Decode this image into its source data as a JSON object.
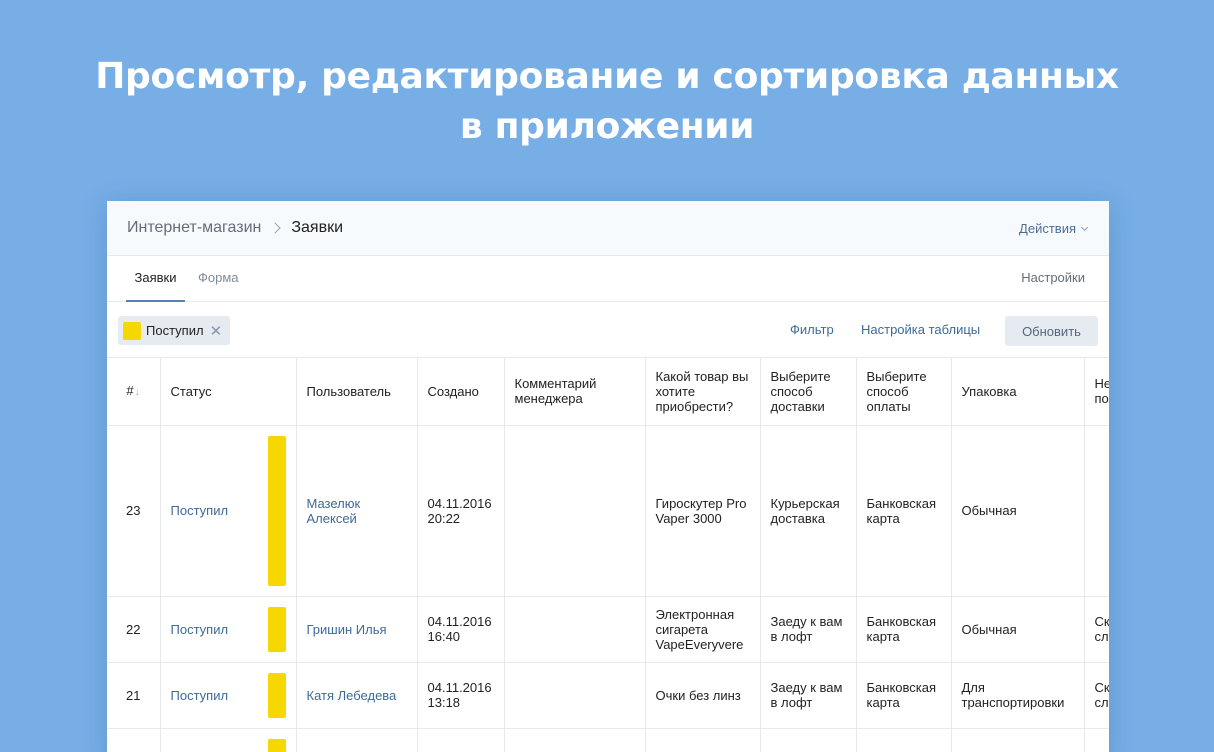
{
  "hero": {
    "line1": "Просмотр, редактирование и сортировка данных",
    "line2": "в приложении"
  },
  "window": {
    "breadcrumb": {
      "parent": "Интернет-магазин",
      "current": "Заявки"
    },
    "actions_label": "Действия",
    "tabs": [
      {
        "label": "Заявки",
        "active": true
      },
      {
        "label": "Форма",
        "active": false
      }
    ],
    "settings_label": "Настройки",
    "toolbar": {
      "filter_chip": {
        "label": "Поступил",
        "color": "#f7d700"
      },
      "filter_label": "Фильтр",
      "table_settings_label": "Настройка таблицы",
      "refresh_label": "Обновить"
    },
    "table": {
      "columns": [
        "#",
        "Статус",
        "Пользователь",
        "Создано",
        "Комментарий менеджера",
        "Какой товар вы хотите приобрести?",
        "Выберите способ доставки",
        "Выберите способ оплаты",
        "Упаковка",
        "Не по"
      ],
      "rows": [
        {
          "id": "23",
          "status": "Поступил",
          "user": "Мазелюк Алексей",
          "date": "04.11.2016",
          "time": "20:22",
          "comment": "",
          "product": "Гироскутер Pro Vaper 3000",
          "delivery": "Курьерская доставка",
          "payment": "Банковская карта",
          "packaging": "Обычная",
          "extra": ""
        },
        {
          "id": "22",
          "status": "Поступил",
          "user": "Гришин Илья",
          "date": "04.11.2016",
          "time": "16:40",
          "comment": "",
          "product": "Электронная сигарета VapeEveryvere",
          "delivery": "Заеду к вам в лофт",
          "payment": "Банковская карта",
          "packaging": "Обычная",
          "extra": "Ск сл то"
        },
        {
          "id": "21",
          "status": "Поступил",
          "user": "Катя Лебедева",
          "date": "04.11.2016",
          "time": "13:18",
          "comment": "",
          "product": "Очки без линз",
          "delivery": "Заеду к вам в лофт",
          "payment": "Банковская карта",
          "packaging": "Для транспортировки",
          "extra": "Ск сл то"
        }
      ]
    },
    "colors": {
      "status": "#f7d700",
      "link": "#3e6a98",
      "background": "#77aee6"
    }
  }
}
